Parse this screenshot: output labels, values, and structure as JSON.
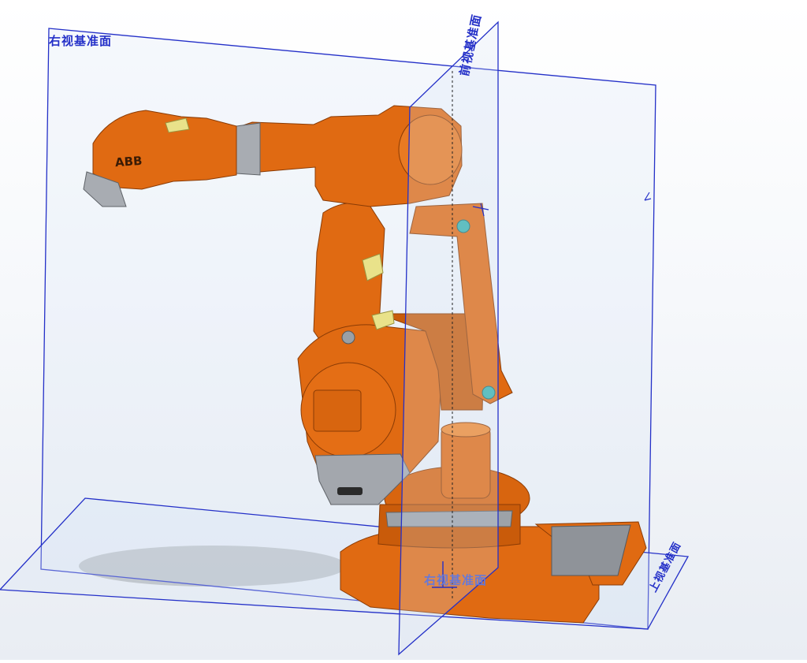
{
  "planes": {
    "right_plane_label": "右视基准面",
    "front_plane_label": "前视基准面",
    "top_plane_label": "上视基准面",
    "origin_label": "右视基准面"
  },
  "model": {
    "brand_logo": "ABB"
  },
  "colors": {
    "robot_orange": "#e06a12",
    "robot_dark": "#b24d08",
    "plane_line": "#2430c8",
    "pad_yellow": "#e9e28a",
    "joint_teal": "#3ab3b0",
    "metal_gray": "#9aa0a6"
  }
}
